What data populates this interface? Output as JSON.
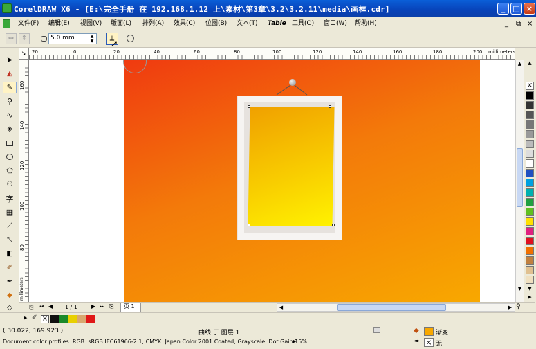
{
  "window": {
    "title": "CorelDRAW X6 - [E:\\完全手册 在 192.168.1.12 上\\素材\\第3章\\3.2\\3.2.11\\media\\画框.cdr]"
  },
  "menu": {
    "items": [
      "文件(F)",
      "编辑(E)",
      "视图(V)",
      "版面(L)",
      "排列(A)",
      "效果(C)",
      "位图(B)",
      "文本(T)",
      "Table",
      "工具(O)",
      "窗口(W)",
      "帮助(H)"
    ]
  },
  "property_bar": {
    "outline_width": "5.0 mm"
  },
  "rulers": {
    "units": "millimeters",
    "top_ticks": [
      "20",
      "0",
      "20",
      "40",
      "60",
      "80",
      "100",
      "120",
      "140",
      "160",
      "180",
      "200"
    ],
    "left_ticks": [
      "160",
      "140",
      "120",
      "100",
      "80"
    ]
  },
  "page_nav": {
    "page_count": "1 / 1",
    "page_tab": "页 1"
  },
  "status": {
    "coordinates": "( 30.022, 169.923 )",
    "object_info": "曲线 于 图层 1",
    "color_profiles": "Document color profiles: RGB: sRGB IEC61966-2.1; CMYK: Japan Color 2001 Coated; Grayscale: Dot Gain 15%",
    "fill_label": "渐变",
    "outline_label": "无"
  },
  "colors": {
    "title_blue": "#0a5fd8",
    "bg_gradient_start": "#f03a10",
    "bg_gradient_end": "#f8a800",
    "picture_gradient_start": "#f0a800",
    "picture_gradient_end": "#fff000",
    "fill_swatch": "#f8a800"
  }
}
